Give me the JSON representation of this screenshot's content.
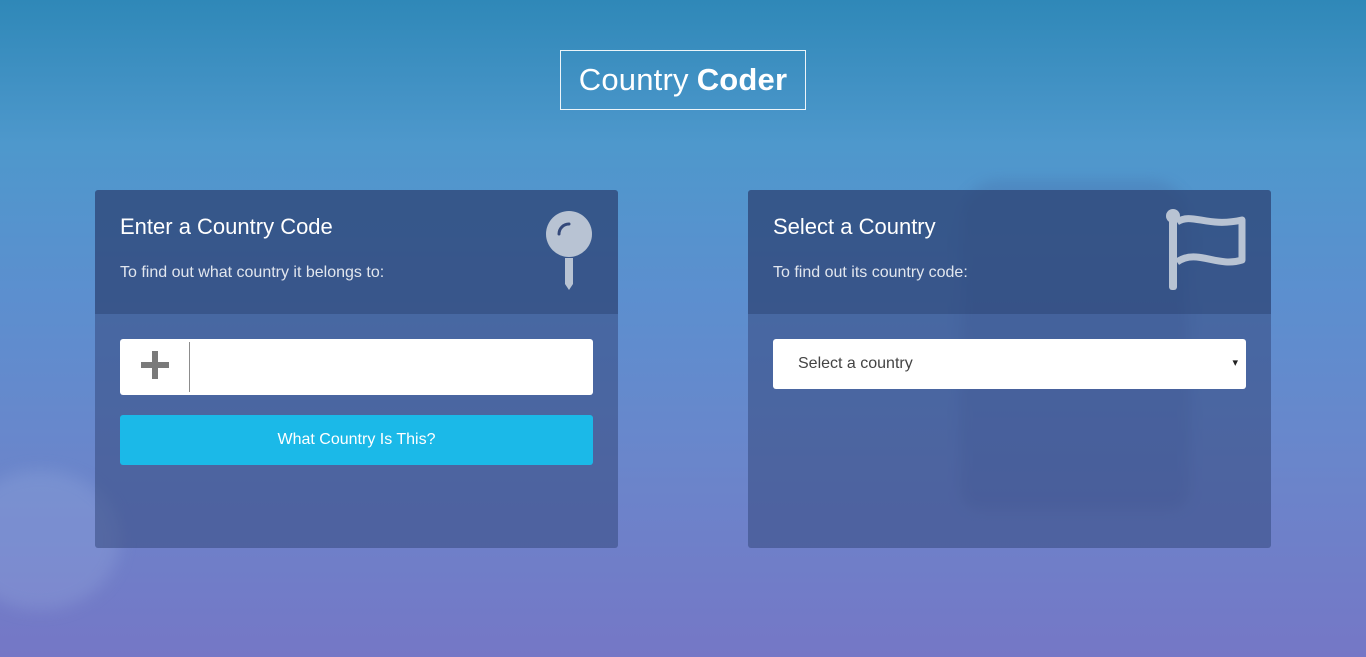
{
  "header": {
    "title_light": "Country",
    "title_bold": "Coder"
  },
  "left_card": {
    "title": "Enter a Country Code",
    "subtitle": "To find out what country it belongs to:",
    "icon": "map-pin-icon",
    "prefix_icon": "plus-icon",
    "input_value": "",
    "input_placeholder": "",
    "button_label": "What Country Is This?"
  },
  "right_card": {
    "title": "Select a Country",
    "subtitle": "To find out its country code:",
    "icon": "flag-icon",
    "select_value": "Select a country",
    "caret": "▾"
  },
  "colors": {
    "button": "#1bb9e8",
    "icon": "#b8c3d3"
  }
}
